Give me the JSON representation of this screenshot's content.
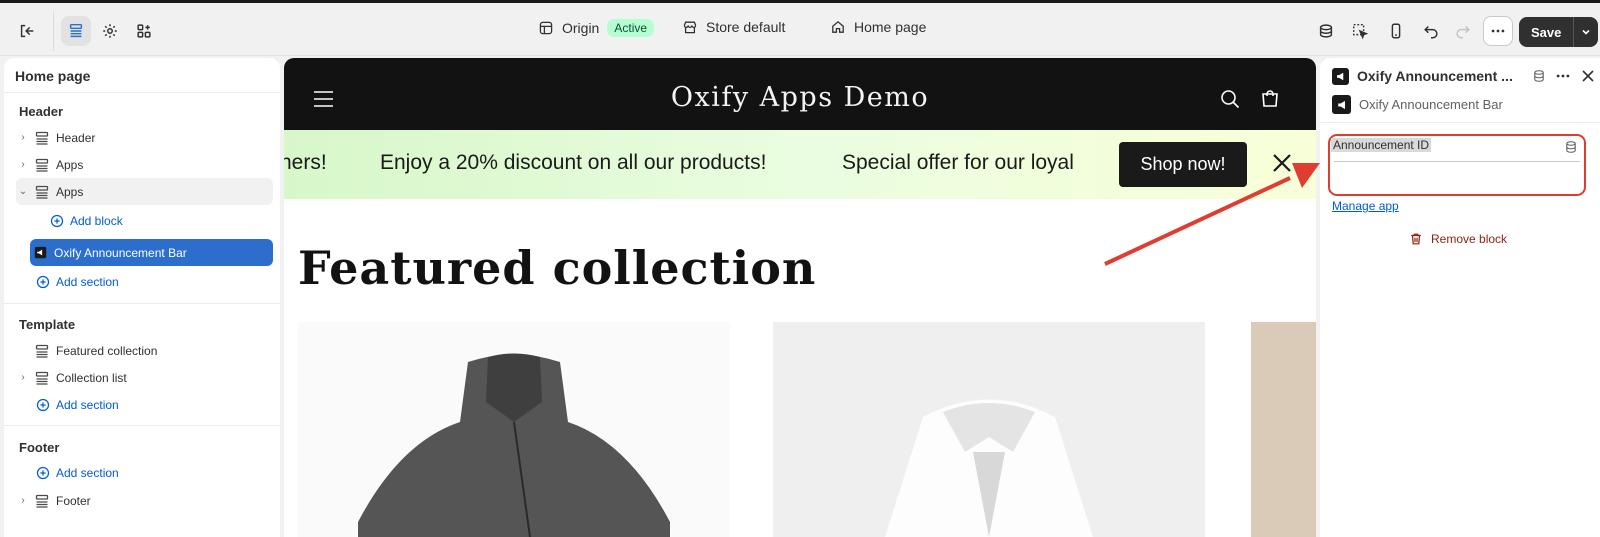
{
  "topbar": {
    "theme_name": "Origin",
    "theme_status": "Active",
    "store_context": "Store default",
    "page_selector": "Home page",
    "save_label": "Save"
  },
  "left_panel": {
    "title": "Home page",
    "groups": [
      {
        "title": "Header"
      },
      {
        "title": "Template"
      },
      {
        "title": "Footer"
      }
    ],
    "items": [
      {
        "label": "Header"
      },
      {
        "label": "Apps"
      },
      {
        "label": "Apps"
      },
      {
        "label": "Add block"
      },
      {
        "label": "Oxify Announcement Bar"
      },
      {
        "label": "Add section"
      },
      {
        "label": "Featured collection"
      },
      {
        "label": "Collection list"
      },
      {
        "label": "Add section"
      },
      {
        "label": "Add section"
      },
      {
        "label": "Footer"
      }
    ]
  },
  "preview": {
    "store_title": "Oxify Apps Demo",
    "announcement_fragment": "ners!",
    "announcement_text": "Enjoy a 20% discount on all our products!",
    "announcement_text_2": "Special offer for our loyal",
    "shop_button": "Shop now!",
    "featured_title": "Featured collection"
  },
  "right_panel": {
    "title": "Oxify Announcement ...",
    "subtitle": "Oxify Announcement Bar",
    "field_label": "Announcement ID",
    "field_value": "",
    "manage_link": "Manage app",
    "remove_label": "Remove block"
  },
  "colors": {
    "accent_selected": "#2c6ecb",
    "link": "#005bd3",
    "annotation_red": "#e03c31",
    "active_badge": "#b4fed2",
    "store_header_bg": "#121212"
  }
}
